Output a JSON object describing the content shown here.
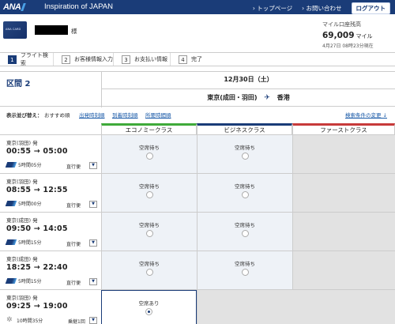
{
  "header": {
    "logo_text": "ANA",
    "tagline": "Inspiration of JAPAN",
    "links": [
      "トップページ",
      "お問い合わせ"
    ],
    "logout": "ログアウト"
  },
  "user": {
    "card_text": "ANA CARD",
    "honorific": "様"
  },
  "miles": {
    "label": "マイル口座残高",
    "value": "69,009",
    "unit": "マイル",
    "as_of": "4月27日 08時23分現在"
  },
  "steps": [
    {
      "num": "1",
      "label": "フライト検索"
    },
    {
      "num": "2",
      "label": "お客様情報入力"
    },
    {
      "num": "3",
      "label": "お支払い情報"
    },
    {
      "num": "4",
      "label": "完了"
    }
  ],
  "segment": {
    "title": "区間 2",
    "date": "12月30日（土）",
    "origin": "東京(成田・羽田)",
    "destination": "香港"
  },
  "sort": {
    "label": "表示並び替え：",
    "current": "おすすめ順",
    "options": [
      "出発時刻順",
      "到着時刻順",
      "所要時間順"
    ],
    "change_conditions": "検索条件の変更"
  },
  "classes": {
    "economy": "エコノミークラス",
    "business": "ビジネスクラス",
    "first": "ファーストクラス"
  },
  "colors": {
    "brand": "#1a3c78",
    "economy": "#3faa3a",
    "business": "#1a3c78",
    "first": "#c73a3a"
  },
  "flights": [
    {
      "from": "東京(羽田) 発",
      "times": "00:55 → 05:00",
      "duration": "5時間05分",
      "type": "直行便",
      "economy": "空席待ち",
      "business": "空席待ち"
    },
    {
      "from": "東京(羽田) 発",
      "times": "08:55 → 12:55",
      "duration": "5時間00分",
      "type": "直行便",
      "economy": "空席待ち",
      "business": "空席待ち"
    },
    {
      "from": "東京(成田) 発",
      "times": "09:50 → 14:05",
      "duration": "5時間15分",
      "type": "直行便",
      "economy": "空席待ち",
      "business": "空席待ち"
    },
    {
      "from": "東京(成田) 発",
      "times": "18:25 → 22:40",
      "duration": "5時間15分",
      "type": "直行便",
      "economy": "空席待ち",
      "business": "空席待ち"
    },
    {
      "from": "東京(羽田) 発",
      "times": "09:25 → 19:00",
      "duration": "10時間35分",
      "type": "乗継1回",
      "economy": "空席あり",
      "business": ""
    }
  ]
}
